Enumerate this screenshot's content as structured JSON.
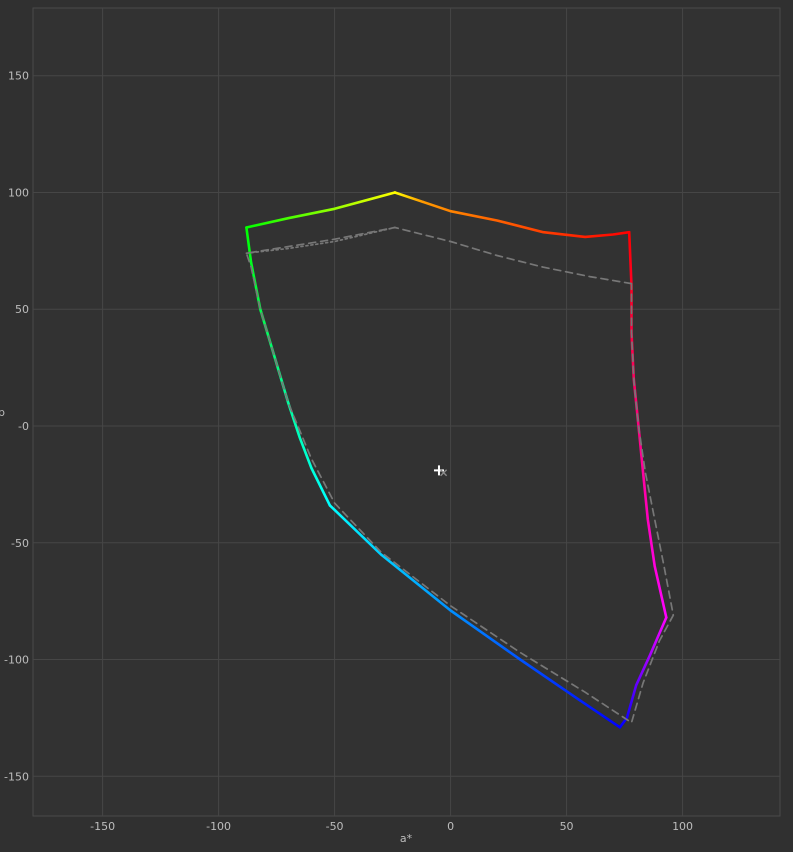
{
  "chart_data": {
    "type": "line",
    "title": "",
    "xlabel": "a*",
    "ylabel": "b",
    "xlim": [
      -180,
      142
    ],
    "ylim": [
      -167,
      179
    ],
    "x_ticks": [
      -150,
      -100,
      -50,
      0,
      50,
      100
    ],
    "y_ticks": [
      150,
      100,
      50,
      0,
      -50,
      -100,
      -150
    ],
    "x_tick_labels": [
      "-150",
      "-100",
      "-50",
      "0",
      "50",
      "100"
    ],
    "y_tick_labels": [
      "150",
      "100",
      "50",
      "-0",
      "-50",
      "-100",
      "-150"
    ],
    "grid": true,
    "background_color": "#303030",
    "grid_color": "#464646",
    "text_color": "#bdbdbd",
    "series": [
      {
        "style": "solid-gradient",
        "segments": [
          {
            "from_color": "#ff0000",
            "to_color": "#ff9900",
            "points": [
              [
                77,
                83
              ],
              [
                70,
                82
              ],
              [
                58,
                81
              ],
              [
                40,
                83
              ],
              [
                20,
                88
              ],
              [
                0,
                92
              ],
              [
                -12,
                96
              ]
            ]
          },
          {
            "from_color": "#ff9900",
            "to_color": "#ffff00",
            "points": [
              [
                -12,
                96
              ],
              [
                -24,
                100
              ]
            ]
          },
          {
            "from_color": "#ffff00",
            "to_color": "#00ff00",
            "points": [
              [
                -24,
                100
              ],
              [
                -50,
                93
              ],
              [
                -70,
                89
              ],
              [
                -88,
                85
              ]
            ]
          },
          {
            "from_color": "#00ff00",
            "to_color": "#00ffff",
            "points": [
              [
                -88,
                85
              ],
              [
                -86,
                70
              ],
              [
                -82,
                50
              ],
              [
                -76,
                30
              ],
              [
                -70,
                10
              ],
              [
                -65,
                -5
              ],
              [
                -60,
                -18
              ],
              [
                -52,
                -34
              ]
            ]
          },
          {
            "from_color": "#00ffff",
            "to_color": "#0000ff",
            "points": [
              [
                -52,
                -34
              ],
              [
                -30,
                -55
              ],
              [
                0,
                -79
              ],
              [
                30,
                -100
              ],
              [
                55,
                -117
              ],
              [
                73,
                -129
              ]
            ]
          },
          {
            "from_color": "#0000ff",
            "to_color": "#ff00ff",
            "points": [
              [
                73,
                -129
              ],
              [
                76,
                -125
              ],
              [
                80,
                -111
              ],
              [
                86,
                -98
              ],
              [
                93,
                -82
              ]
            ]
          },
          {
            "from_color": "#ff00ff",
            "to_color": "#ff0000",
            "points": [
              [
                93,
                -82
              ],
              [
                88,
                -60
              ],
              [
                85,
                -40
              ],
              [
                83,
                -20
              ],
              [
                81,
                0
              ],
              [
                79,
                20
              ],
              [
                78,
                40
              ],
              [
                78,
                60
              ],
              [
                77,
                83
              ]
            ]
          }
        ]
      },
      {
        "style": "dashed",
        "color": "#777777",
        "points": [
          [
            78,
            61
          ],
          [
            60,
            64
          ],
          [
            40,
            68
          ],
          [
            20,
            73
          ],
          [
            0,
            79
          ],
          [
            -24,
            85
          ],
          [
            -50,
            80
          ],
          [
            -88,
            74
          ],
          [
            -86,
            68
          ],
          [
            -82,
            50
          ],
          [
            -76,
            30
          ],
          [
            -70,
            10
          ],
          [
            -60,
            -14
          ],
          [
            -50,
            -33
          ],
          [
            -30,
            -54
          ],
          [
            0,
            -77
          ],
          [
            30,
            -97
          ],
          [
            58,
            -114
          ],
          [
            78,
            -127
          ],
          [
            83,
            -110
          ],
          [
            90,
            -92
          ],
          [
            96,
            -81
          ],
          [
            92,
            -60
          ],
          [
            88,
            -40
          ],
          [
            84,
            -20
          ],
          [
            81,
            0
          ],
          [
            79,
            20
          ],
          [
            78,
            40
          ],
          [
            78,
            61
          ]
        ]
      },
      {
        "style": "dotted",
        "color": "#777777",
        "points": [
          [
            -88,
            74
          ],
          [
            -70,
            76
          ],
          [
            -50,
            79
          ],
          [
            -24,
            85
          ]
        ]
      }
    ],
    "white_point": [
      -5,
      -19
    ],
    "secondary_point": [
      -3,
      -20
    ]
  }
}
